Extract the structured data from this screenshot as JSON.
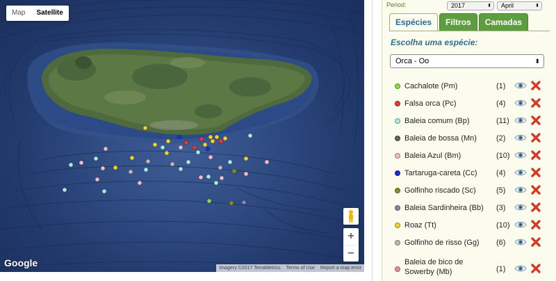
{
  "map": {
    "maptype_buttons": [
      "Map",
      "Satellite"
    ],
    "active_maptype": "Satellite",
    "zoom_in": "+",
    "zoom_out": "−",
    "logo": "Google",
    "attribution": [
      "Imagery ©2017 TerraMetrics",
      "Terms of Use",
      "Report a map error"
    ]
  },
  "panel": {
    "period_label": "Period:",
    "year": "2017",
    "month": "April",
    "tabs": [
      "Espécies",
      "Filtros",
      "Camadas"
    ],
    "active_tab": "Espécies",
    "prompt": "Escolha uma espécie:",
    "selected_species": "Orca - Oo",
    "species": [
      {
        "name": "Cachalote (Pm)",
        "count": "(1)",
        "color": "#8bd94a"
      },
      {
        "name": "Falsa orca (Pc)",
        "count": "(4)",
        "color": "#e33b3b"
      },
      {
        "name": "Baleia comum (Bp)",
        "count": "(11)",
        "color": "#a6ecdf"
      },
      {
        "name": "Baleia de bossa (Mn)",
        "count": "(2)",
        "color": "#5d6a5b"
      },
      {
        "name": "Baleia Azul (Bm)",
        "count": "(10)",
        "color": "#f4b8c8"
      },
      {
        "name": "Tartaruga-careta (Cc)",
        "count": "(4)",
        "color": "#1a2fd6"
      },
      {
        "name": "Golfinho riscado (Sc)",
        "count": "(5)",
        "color": "#8d8d22"
      },
      {
        "name": "Baleia Sardinheira (Bb)",
        "count": "(3)",
        "color": "#8a86a8"
      },
      {
        "name": "Roaz (Tt)",
        "count": "(10)",
        "color": "#f2d232"
      },
      {
        "name": "Golfinho de risso (Gg)",
        "count": "(6)",
        "color": "#bcbcad"
      },
      {
        "name": "Baleia de bico de Sowerby (Mb)",
        "count": "(1)",
        "color": "#f08a96"
      }
    ],
    "icon_names": {
      "view": "eye-icon",
      "remove": "delete-x-icon"
    }
  }
}
